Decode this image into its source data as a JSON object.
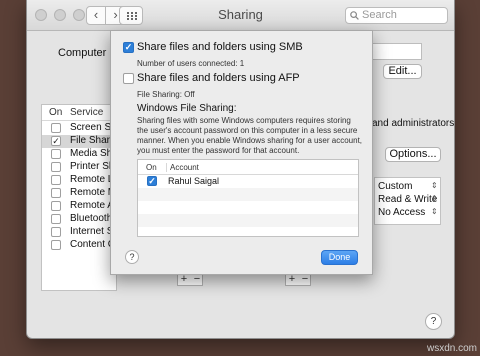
{
  "window": {
    "title": "Sharing",
    "search_placeholder": "Search"
  },
  "computer_name": {
    "label": "Computer Na",
    "edit_label": "Edit..."
  },
  "services": {
    "col_on": "On",
    "col_service": "Service",
    "items": [
      {
        "label": "Screen Sha",
        "checked": false
      },
      {
        "label": "File Sharing",
        "checked": true
      },
      {
        "label": "Media Shar",
        "checked": false
      },
      {
        "label": "Printer Sha",
        "checked": false
      },
      {
        "label": "Remote Log",
        "checked": false
      },
      {
        "label": "Remote Ma",
        "checked": false
      },
      {
        "label": "Remote Ap",
        "checked": false
      },
      {
        "label": "Bluetooth S",
        "checked": false
      },
      {
        "label": "Internet Sh",
        "checked": false
      },
      {
        "label": "Content Ca",
        "checked": false
      }
    ]
  },
  "right_panel": {
    "admin_text": "and administrators",
    "options_label": "Options...",
    "permissions": [
      "Custom",
      "Read & Write",
      "No Access"
    ]
  },
  "sheet": {
    "smb_label": "Share files and folders using SMB",
    "smb_checked": true,
    "users_connected": "Number of users connected: 1",
    "afp_label": "Share files and folders using AFP",
    "afp_checked": false,
    "afp_status": "File Sharing: Off",
    "windows_heading": "Windows File Sharing:",
    "windows_desc": "Sharing files with some Windows computers requires storing the user's account password on this computer in a less secure manner. When you enable Windows sharing for a user account, you must enter the password for that account.",
    "accounts": {
      "col_on": "On",
      "col_account": "Account",
      "rows": [
        {
          "name": "Rahul Saigal",
          "checked": true
        }
      ]
    },
    "done_label": "Done",
    "help_label": "?"
  },
  "controls": {
    "plus": "+",
    "minus": "−",
    "help": "?"
  },
  "watermark": "wsxdn.com"
}
